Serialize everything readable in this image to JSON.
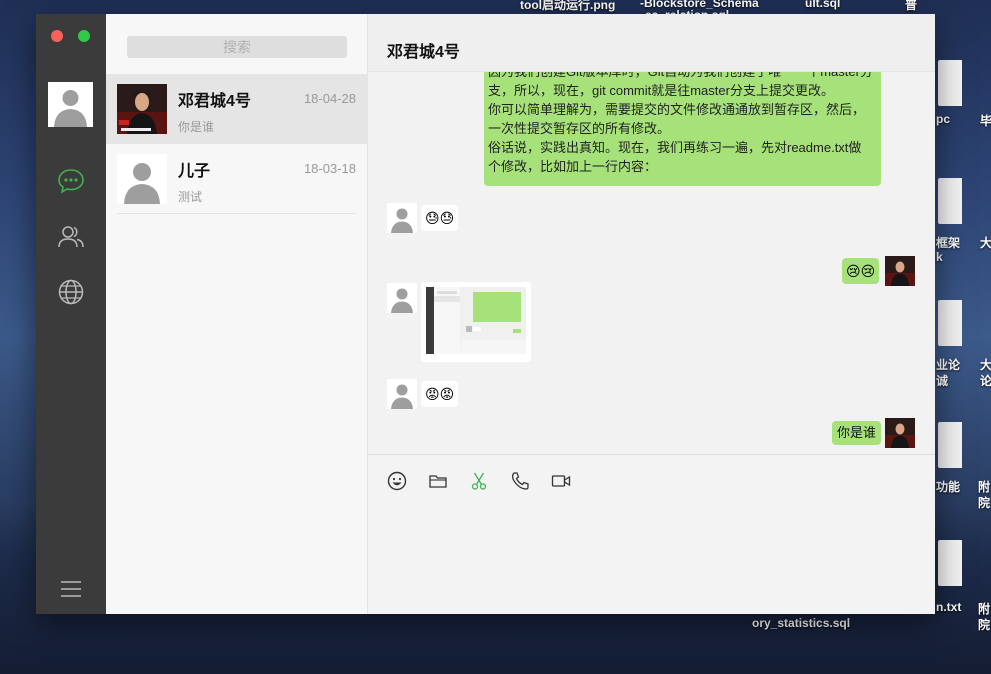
{
  "desktop": {
    "labels": [
      "tool启动运行.png",
      "-Blockstore_Schema",
      "ea_relation.sql",
      "ult.sql",
      "普",
      "pc",
      "毕",
      "框架",
      "k",
      "大",
      "业论",
      "诚",
      "大",
      "论",
      "功能",
      "附",
      "院",
      "n.txt",
      "附",
      "院",
      "ory_statistics.sql"
    ]
  },
  "sidebar": {
    "icons": [
      "chat-icon",
      "contacts-icon",
      "globe-icon",
      "menu-icon"
    ]
  },
  "search": {
    "placeholder": "搜索"
  },
  "conversations": [
    {
      "name": "邓君城4号",
      "date": "18-04-28",
      "preview": "你是谁",
      "active": true
    },
    {
      "name": "儿子",
      "date": "18-03-18",
      "preview": "测试",
      "active": false
    }
  ],
  "chat": {
    "title": "邓君城4号",
    "big_message_lines": [
      "因为我们创建Git版本库时，Git自动为我们创建了唯一一个master分",
      "支，所以，现在，git commit就是往master分支上提交更改。",
      "你可以简单理解为，需要提交的文件修改通通放到暂存区，然后，",
      "一次性提交暂存区的所有修改。",
      "俗话说，实践出真知。现在，我们再练习一遍，先对readme.txt做",
      "个修改，比如加上一行内容："
    ],
    "emoji_in_1": "😓😓",
    "emoji_out_1": "😢😢",
    "emoji_in_2": "😡😡",
    "text_out": "你是谁"
  },
  "composer": {
    "tools": [
      "emoji-icon",
      "folder-icon",
      "scissors-icon",
      "phone-icon",
      "video-icon"
    ],
    "scissors_color": "#3fb34f"
  },
  "colors": {
    "accent_green": "#3fb34f",
    "bubble_green": "#a6e279",
    "rail": "#3b3b3b"
  }
}
